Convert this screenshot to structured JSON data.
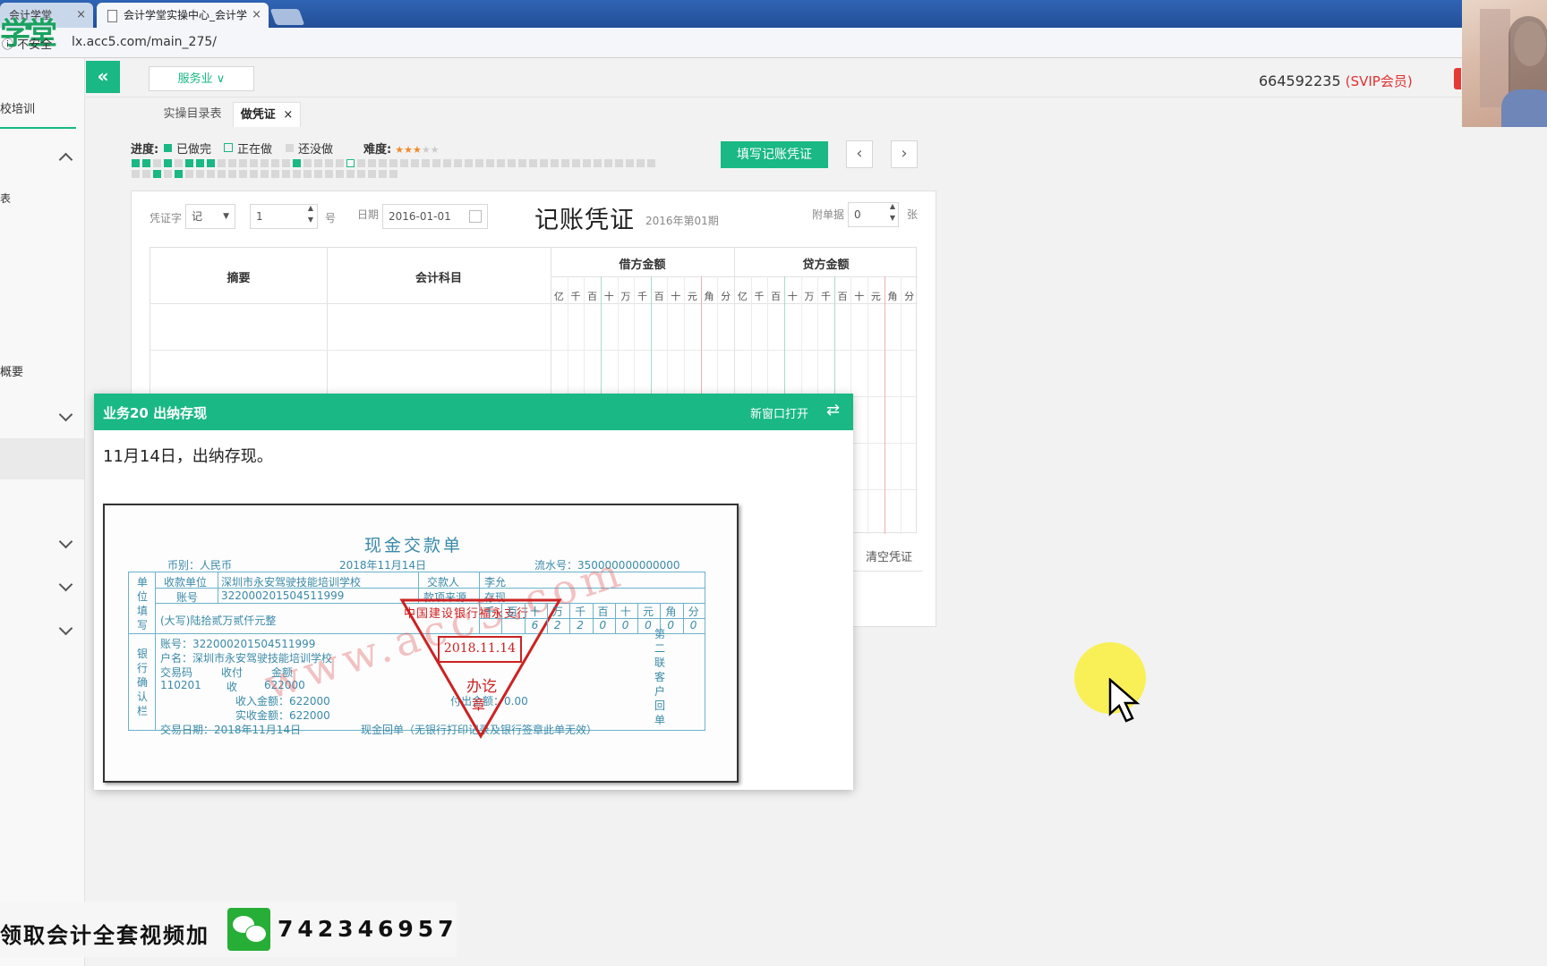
{
  "browser": {
    "tabs": [
      {
        "label": "会计学堂",
        "close": "×"
      },
      {
        "label": "会计学堂实操中心_会计学",
        "close": "×"
      }
    ],
    "secure_label": "不安全",
    "url": "lx.acc5.com/main_275/",
    "logo_text": "学堂"
  },
  "sidebar": {
    "items": [
      "校培训",
      "表",
      "概要"
    ]
  },
  "header": {
    "collapse_symbol": "«",
    "service_label": "服务业 ∨",
    "account_id": "664592235",
    "account_vip": "(SVIP会员)"
  },
  "subtabs": [
    {
      "label": "实操目录表"
    },
    {
      "label": "做凭证",
      "close": "×"
    }
  ],
  "progress": {
    "label": "进度:",
    "legend": [
      "已做完",
      "正在做",
      "还没做"
    ],
    "difficulty_label": "难度:",
    "difficulty_stars": 3,
    "difficulty_max": 5,
    "colors": {
      "done": "#19b884",
      "todo": "#d8d8d8"
    }
  },
  "toolbar": {
    "fill_label": "填写记账凭证",
    "prev": "‹",
    "next": "›"
  },
  "voucher": {
    "voucher_word_label": "凭证字",
    "voucher_word_value": "记",
    "number_value": "1",
    "number_suffix": "号",
    "date_label": "日期",
    "date_value": "2016-01-01",
    "title": "记账凭证",
    "period": "2016年第01期",
    "attach_label": "附单据",
    "attach_value": "0",
    "attach_unit": "张",
    "columns": {
      "summary": "摘要",
      "account": "会计科目",
      "debit": "借方金额",
      "credit": "贷方金额"
    },
    "digits": [
      "亿",
      "千",
      "百",
      "十",
      "万",
      "千",
      "百",
      "十",
      "元",
      "角",
      "分"
    ],
    "clear_label": "清空凭证"
  },
  "task": {
    "title": "业务20 出纳存现",
    "new_window_label": "新窗口打开",
    "description": "11月14日，出纳存现。"
  },
  "receipt": {
    "title": "现金交款单",
    "currency": "币别：人民币",
    "date": "2018年11月14日",
    "serial": "流水号：350000000000000",
    "left_unit": [
      "单",
      "位",
      "填",
      "写"
    ],
    "left_bank": [
      "银",
      "行",
      "确",
      "认",
      "栏"
    ],
    "payee_label": "收款单位",
    "payee": "深圳市永安驾驶技能培训学校",
    "payer_label": "交款人",
    "payer": "李允",
    "account_label": "账号",
    "account": "322000201504511999",
    "source_label": "款项来源",
    "source": "存现",
    "amount_words": "(大写)陆拾贰万贰仟元整",
    "amount_digits_head": [
      "千",
      "百",
      "十",
      "万",
      "千",
      "百",
      "十",
      "元",
      "角",
      "分"
    ],
    "amount_digits": [
      "",
      "",
      "6",
      "2",
      "2",
      "0",
      "0",
      "0",
      "0",
      "0"
    ],
    "bank_account": "账号：322000201504511999",
    "bank_name": "户名：深圳市永安驾驶技能培训学校",
    "tx_code_label": "交易码",
    "tx_type_label": "收付",
    "tx_amount_label": "金额",
    "tx_code": "110201",
    "tx_type": "收",
    "tx_amount": "622000",
    "income_total": "收入金额：622000",
    "actual_total": "实收金额：622000",
    "pay_total": "付出金额：0.00",
    "tx_date": "交易日期：2018年11月14日",
    "note": "现金回单（无银行打印记录及银行签章此单无效）",
    "side_copy": [
      "第",
      "二",
      "联",
      "客",
      "户",
      "回",
      "单"
    ],
    "stamp_bank": "中国建设银行福永支行",
    "stamp_date": "2018.11.14",
    "stamp_sign": "办讫",
    "stamp_seal": "章",
    "watermark": "www.acc5.com"
  },
  "banner": {
    "text": "领取会计全套视频加",
    "number": "742346957"
  }
}
